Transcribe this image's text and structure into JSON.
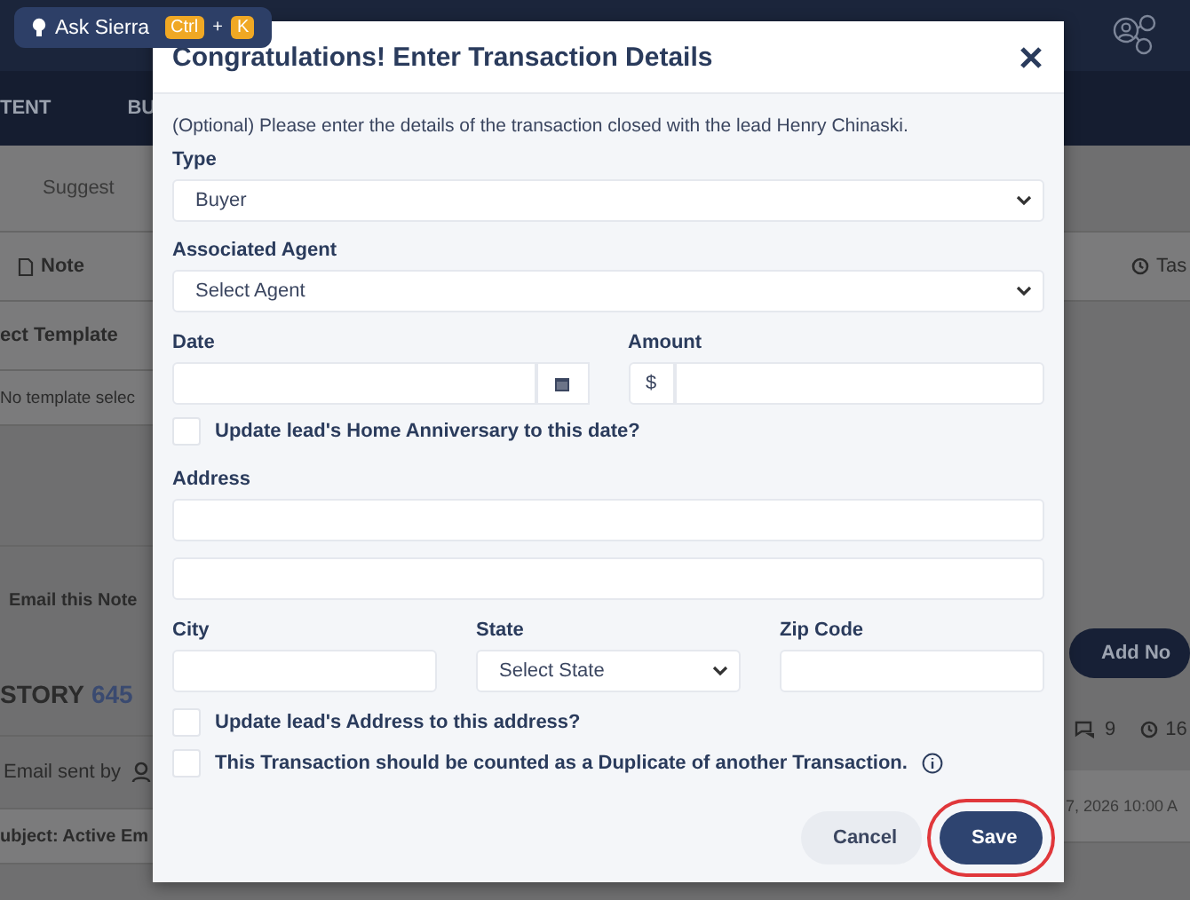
{
  "assistant_button": {
    "label": "Ask Sierra",
    "shortcut_keys": [
      "Ctrl",
      "K"
    ],
    "separator": "+"
  },
  "background": {
    "nav_tabs": [
      "TENT",
      "BU"
    ],
    "suggest_button": "Suggest",
    "note_tab": "Note",
    "task_tab": "Tas",
    "template_label": "ect Template",
    "template_value": "No template selec",
    "email_note": "Email this Note",
    "add_note_button": "Add No",
    "history": {
      "title": "STORY",
      "count": "645",
      "comments": "9",
      "time_count": "16"
    },
    "entry": {
      "sender_label": "Email sent by",
      "date": "7, 2026 10:00 A",
      "subject": "ubject: Active Em"
    }
  },
  "dialog": {
    "title": "Congratulations! Enter Transaction Details",
    "intro": "(Optional) Please enter the details of the transaction closed with the lead Henry Chinaski.",
    "type": {
      "label": "Type",
      "value": "Buyer"
    },
    "agent": {
      "label": "Associated Agent",
      "placeholder": "Select Agent"
    },
    "date": {
      "label": "Date"
    },
    "amount": {
      "label": "Amount",
      "prefix": "$"
    },
    "anniversary_checkbox": {
      "label": "Update lead's Home Anniversary to this date?",
      "checked": false
    },
    "address": {
      "label": "Address"
    },
    "city": {
      "label": "City"
    },
    "state": {
      "label": "State",
      "placeholder": "Select State"
    },
    "zip": {
      "label": "Zip Code"
    },
    "address_checkbox": {
      "label": "Update lead's Address to this address?",
      "checked": false
    },
    "duplicate_checkbox": {
      "label": "This Transaction should be counted as a Duplicate of another Transaction.",
      "checked": false
    },
    "buttons": [
      {
        "label": "Cancel",
        "kind": "secondary",
        "highlighted": false
      },
      {
        "label": "Save",
        "kind": "primary",
        "highlighted": true
      }
    ]
  }
}
